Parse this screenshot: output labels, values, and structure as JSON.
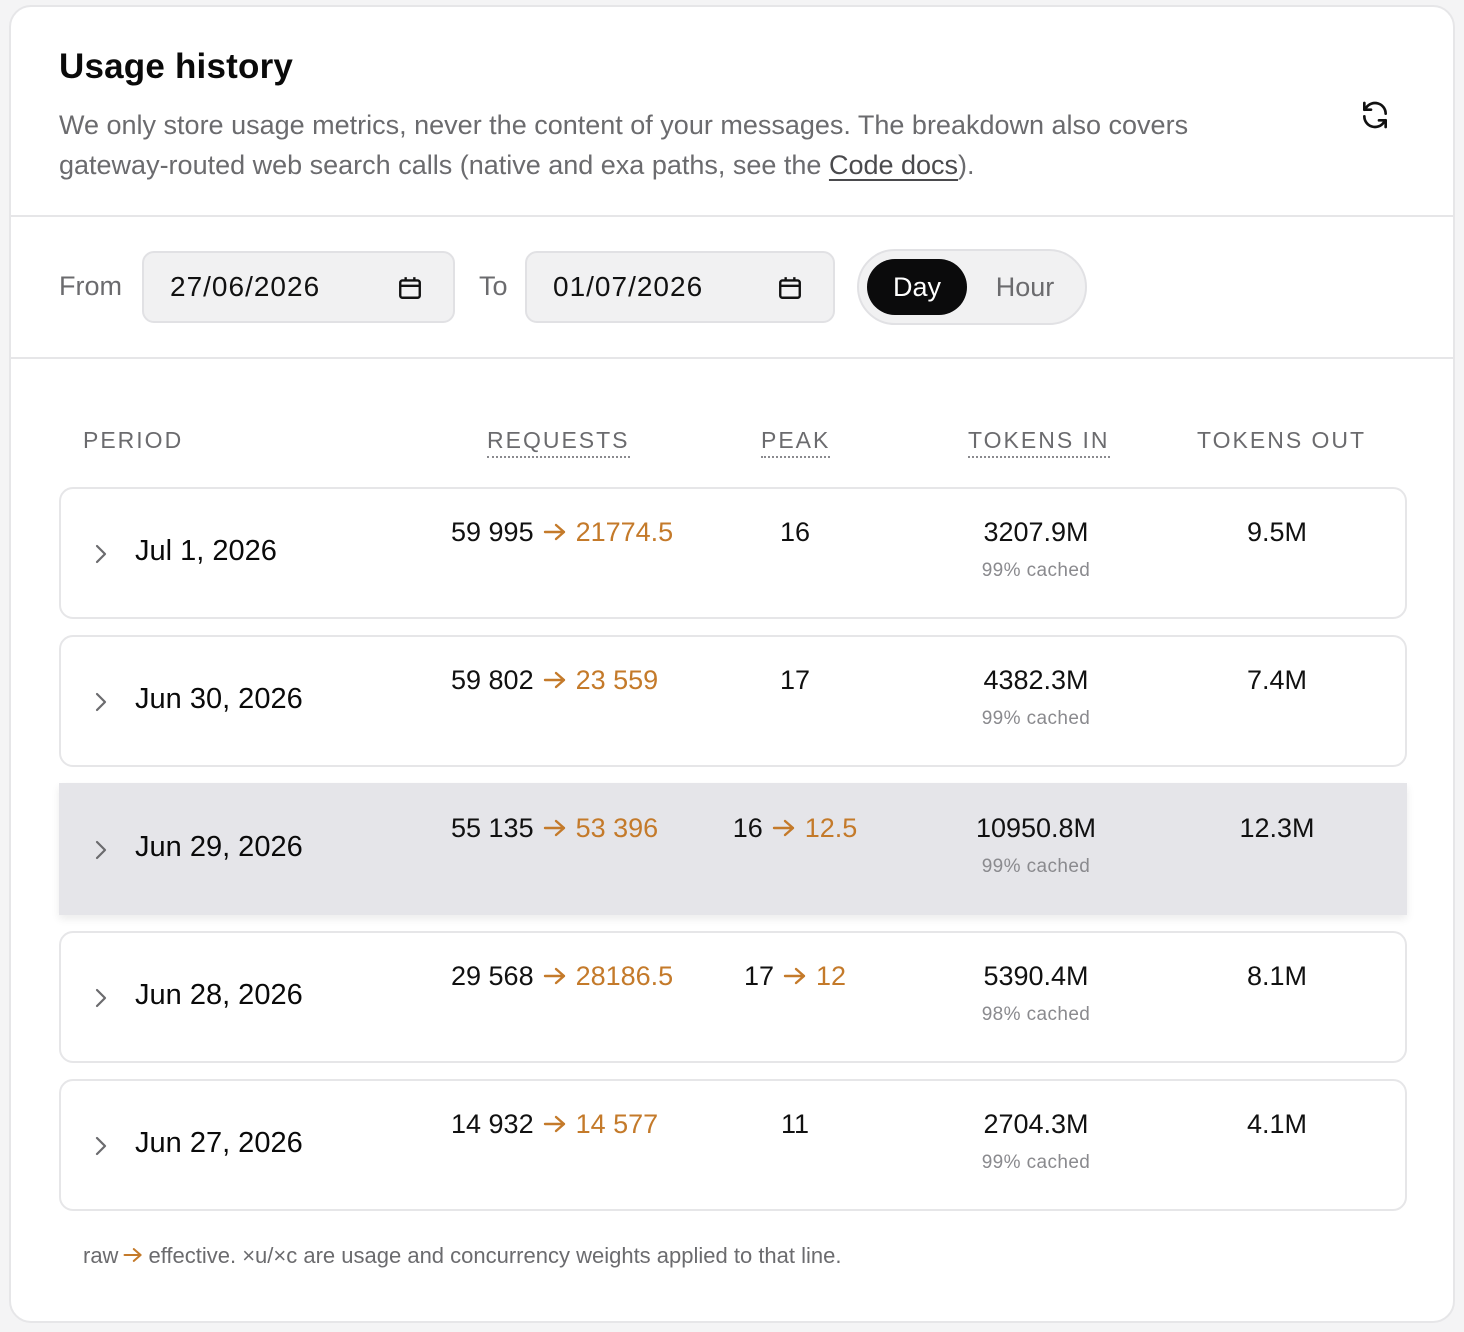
{
  "header": {
    "title": "Usage history",
    "description_pre": "We only store usage metrics, never the content of your messages. The breakdown also covers gateway-routed web search calls (native and exa paths, see the ",
    "description_link": "Code docs",
    "description_post": ")."
  },
  "filters": {
    "from_label": "From",
    "from_value": "27/06/2026",
    "to_label": "To",
    "to_value": "01/07/2026",
    "granularity_options": [
      "Day",
      "Hour"
    ],
    "granularity_selected": "Day"
  },
  "table": {
    "columns": [
      "PERIOD",
      "REQUESTS",
      "PEAK",
      "TOKENS IN",
      "TOKENS OUT"
    ],
    "rows": [
      {
        "period": "Jul 1, 2026",
        "requests_raw": "59 995",
        "requests_eff": "21774.5",
        "peak_raw": "16",
        "peak_eff": "",
        "tokens_in": "3207.9M",
        "cached": "99% cached",
        "tokens_out": "9.5M",
        "highlighted": false
      },
      {
        "period": "Jun 30, 2026",
        "requests_raw": "59 802",
        "requests_eff": "23 559",
        "peak_raw": "17",
        "peak_eff": "",
        "tokens_in": "4382.3M",
        "cached": "99% cached",
        "tokens_out": "7.4M",
        "highlighted": false
      },
      {
        "period": "Jun 29, 2026",
        "requests_raw": "55 135",
        "requests_eff": "53 396",
        "peak_raw": "16",
        "peak_eff": "12.5",
        "tokens_in": "10950.8M",
        "cached": "99% cached",
        "tokens_out": "12.3M",
        "highlighted": true
      },
      {
        "period": "Jun 28, 2026",
        "requests_raw": "29 568",
        "requests_eff": "28186.5",
        "peak_raw": "17",
        "peak_eff": "12",
        "tokens_in": "5390.4M",
        "cached": "98% cached",
        "tokens_out": "8.1M",
        "highlighted": false
      },
      {
        "period": "Jun 27, 2026",
        "requests_raw": "14 932",
        "requests_eff": "14 577",
        "peak_raw": "11",
        "peak_eff": "",
        "tokens_in": "2704.3M",
        "cached": "99% cached",
        "tokens_out": "4.1M",
        "highlighted": false
      }
    ]
  },
  "footnote": {
    "pre": "raw",
    "post": "effective. ×u/×c are usage and concurrency weights applied to that line."
  },
  "colors": {
    "effective": "#c47a2a",
    "selected_segment": "#0b0b0c",
    "highlight_row": "#e5e5e9"
  },
  "icons": [
    "refresh-icon",
    "calendar-icon",
    "chevron-right-icon",
    "arrow-right-icon"
  ]
}
